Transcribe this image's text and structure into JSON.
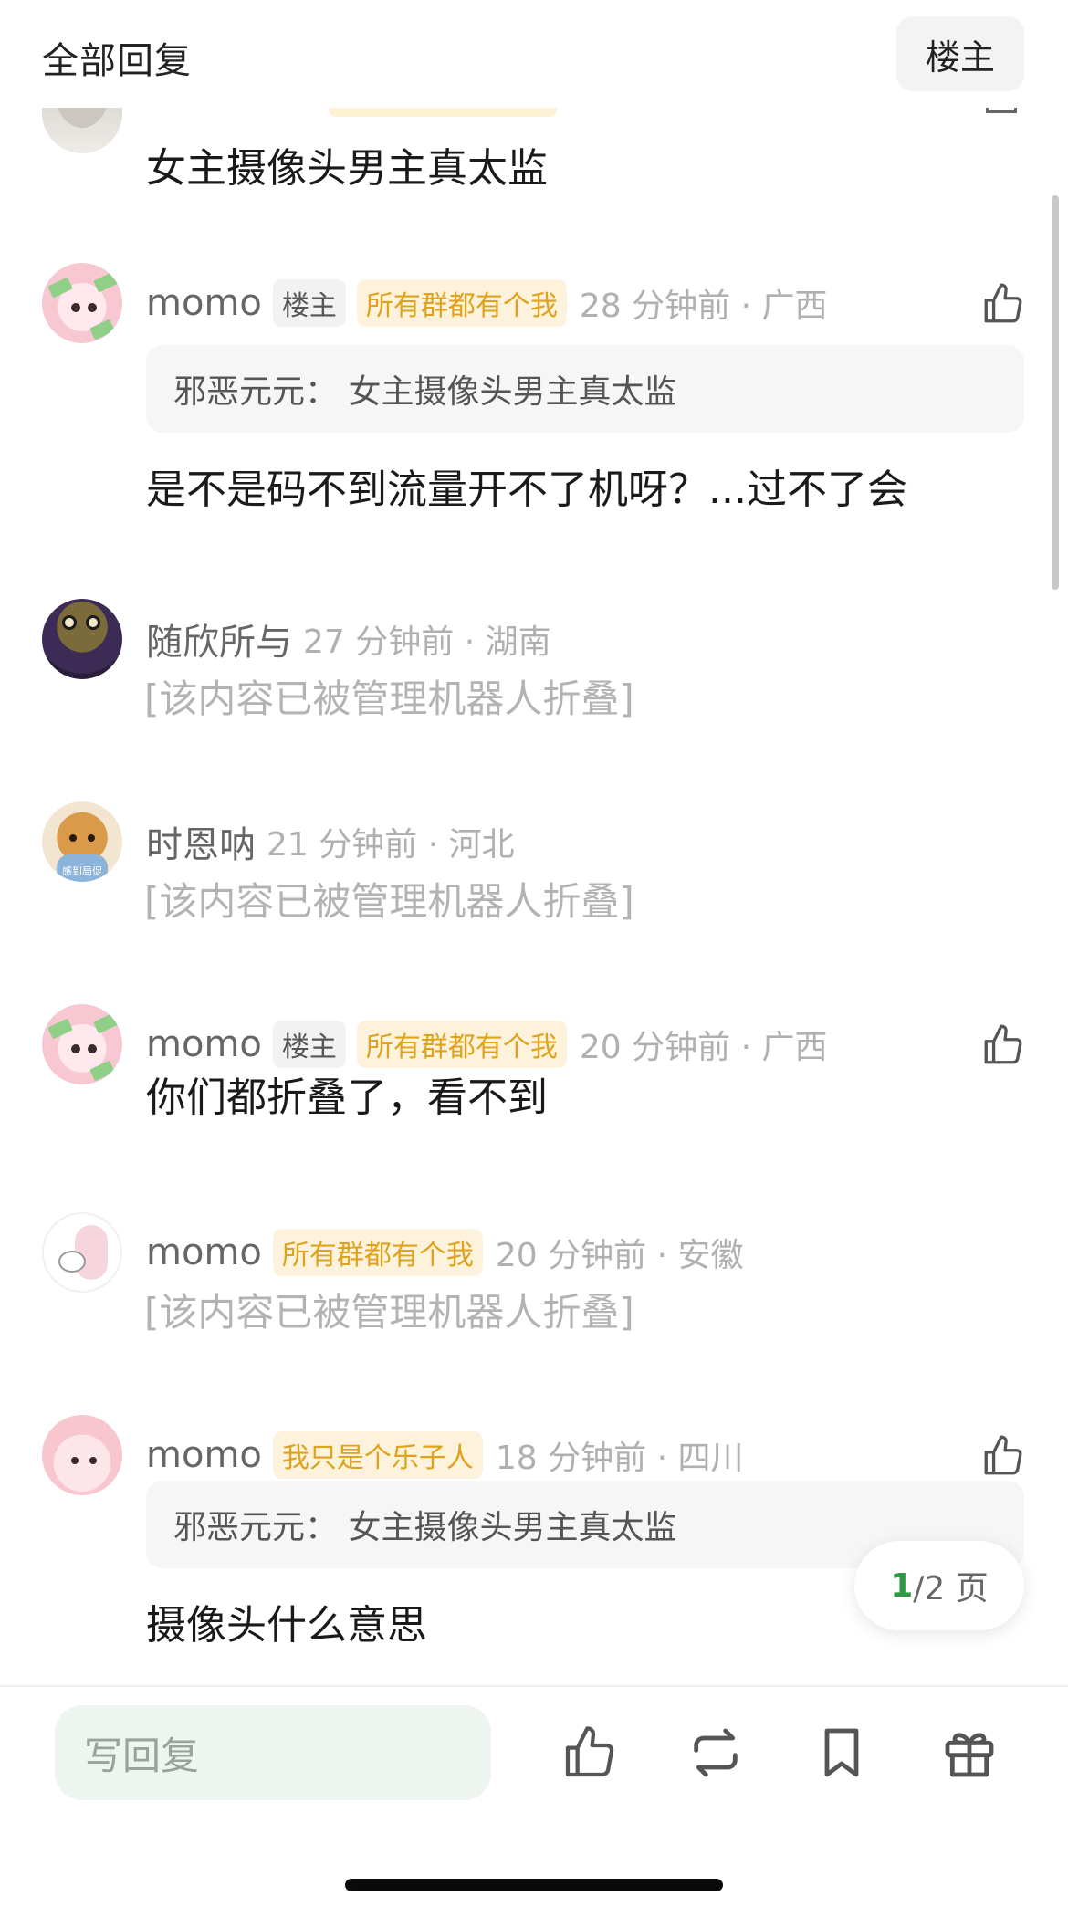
{
  "header": {
    "title": "全部回复",
    "host_button": "楼主"
  },
  "partial_top": {
    "text": "女主摄像头男主真太监"
  },
  "comments": [
    {
      "name": "momo",
      "host_badge": "楼主",
      "tag": "所有群都有个我",
      "time": "28 分钟前 · 广西",
      "quote": "邪恶元元：  女主摄像头男主真太监",
      "text": "是不是码不到流量开不了机呀？...过不了会"
    },
    {
      "name": "随欣所与",
      "time": "27 分钟前 · 湖南",
      "text": "[该内容已被管理机器人折叠]"
    },
    {
      "name": "时恩呐",
      "time": "21 分钟前 · 河北",
      "text": "[该内容已被管理机器人折叠]",
      "avatar_caption": "感到局促"
    },
    {
      "name": "momo",
      "host_badge": "楼主",
      "tag": "所有群都有个我",
      "time": "20 分钟前 · 广西",
      "text": "你们都折叠了，看不到"
    },
    {
      "name": "momo",
      "tag": "所有群都有个我",
      "time": "20 分钟前 · 安徽",
      "text": "[该内容已被管理机器人折叠]"
    },
    {
      "name": "momo",
      "tag": "我只是个乐子人",
      "time": "18 分钟前 · 四川",
      "quote": "邪恶元元：  女主摄像头男主真太监",
      "text": "摄像头什么意思"
    }
  ],
  "pagination": {
    "current": "1",
    "total_text": "/2 页"
  },
  "bottom_bar": {
    "reply_placeholder": "写回复"
  },
  "icons": [
    "like-icon",
    "repost-icon",
    "bookmark-icon",
    "gift-icon"
  ],
  "colors": {
    "accent_green": "#2f9a45",
    "tag_text": "#e0a21a",
    "tag_bg": "#fdf3dc",
    "muted": "#b0b0b0"
  }
}
